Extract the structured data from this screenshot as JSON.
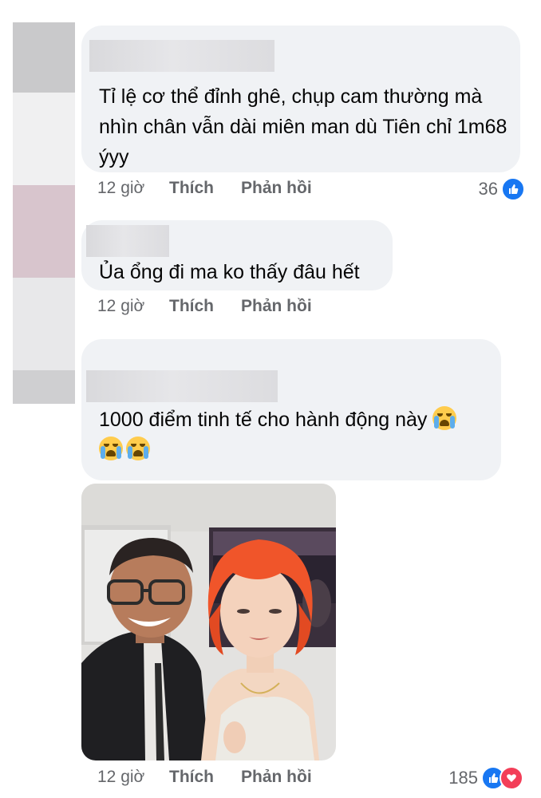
{
  "comments": [
    {
      "text": "Tỉ lệ cơ thể đỉnh ghê, chụp cam thường mà nhìn chân vẫn dài miên man dù Tiên chỉ 1m68 ýyy",
      "time": "12 giờ",
      "like": "Thích",
      "reply": "Phản hồi",
      "reaction_count": "36"
    },
    {
      "text": "Ủa ổng đi ma ko thấy đâu hết",
      "time": "12 giờ",
      "like": "Thích",
      "reply": "Phản hồi"
    },
    {
      "text": "1000 điểm tinh tế cho hành động này",
      "time": "12 giờ",
      "like": "Thích",
      "reply": "Phản hồi",
      "reaction_count": "185",
      "emoji": "loudly-crying-face",
      "has_photo": true
    }
  ],
  "colors": {
    "bubble": "#f0f2f5",
    "meta_text": "#65676b",
    "like_blue": "#1877f2",
    "love_red": "#f33e58",
    "hair_orange": "#f0552a"
  },
  "icons": [
    "like-icon",
    "love-icon",
    "crying-face-emoji"
  ]
}
